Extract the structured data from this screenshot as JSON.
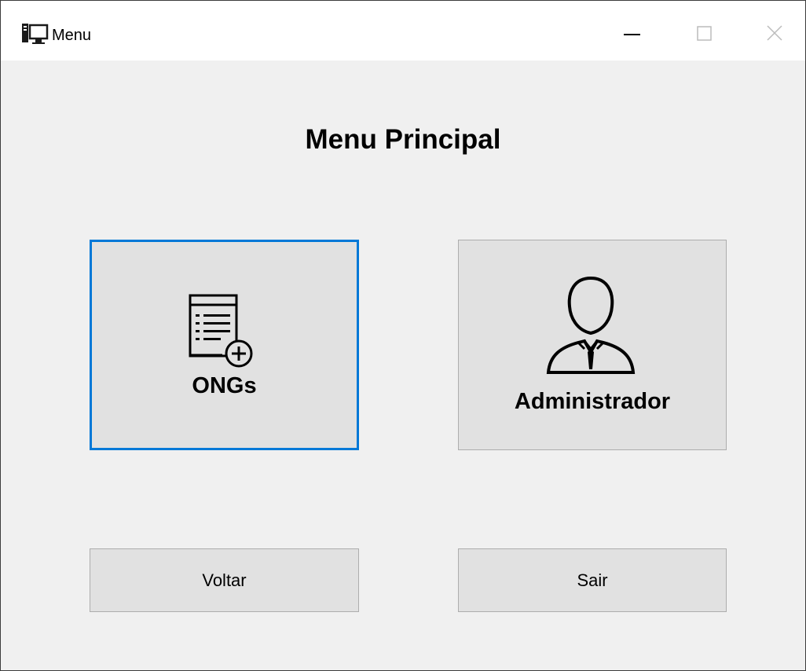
{
  "window": {
    "title": "Menu",
    "app_icon": "computer-icon",
    "controls": {
      "minimize": "minimize-icon",
      "maximize": "maximize-icon",
      "close": "close-icon"
    }
  },
  "main": {
    "heading": "Menu Principal",
    "ongs_button": {
      "label": "ONGs",
      "icon": "document-add-icon"
    },
    "admin_button": {
      "label": "Administrador",
      "icon": "user-icon"
    },
    "back_button": {
      "label": "Voltar"
    },
    "exit_button": {
      "label": "Sair"
    }
  },
  "colors": {
    "focus_border": "#0078d7",
    "window_bg": "#f0f0f0",
    "button_bg": "#e1e1e1",
    "button_border": "#adadad"
  }
}
